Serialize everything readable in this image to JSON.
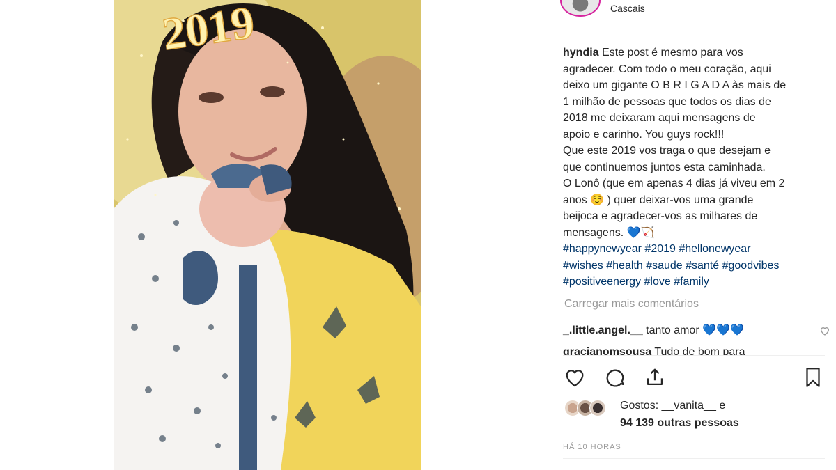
{
  "post": {
    "location": "Cascais",
    "username": "hyndia",
    "caption_lines": [
      "Este post é mesmo para vos",
      "agradecer. Com todo o meu coração, aqui",
      "deixo um gigante O B R I G A D A às mais de",
      "1 milhão de pessoas que todos os dias de",
      "2018 me deixaram aqui mensagens de",
      "apoio e carinho. You guys rock!!!",
      "Que este 2019 vos traga o que desejam e",
      "que continuemos juntos esta caminhada.",
      "O Lonô (que em apenas 4 dias já viveu em 2",
      "anos ☺️ ) quer deixar-vos uma grande",
      "beijoca e agradecer-vos as milhares de",
      "mensagens. 💙🏹"
    ],
    "hashtag_lines": [
      "#happynewyear #2019 #hellonewyear",
      "#wishes #health #saude #santé #goodvibes",
      "#positiveenergy #love #family"
    ]
  },
  "comments": {
    "load_more": "Carregar mais comentários",
    "items": [
      {
        "user": "_.little.angel.__",
        "text": "tanto amor 💙💙💙"
      },
      {
        "user": "gracianomsousa",
        "text": "Tudo de bom para"
      }
    ]
  },
  "likes": {
    "prefix": "Gostos: ",
    "user": "__vanita__",
    "connector": " e",
    "others": "94 139 outras pessoas"
  },
  "time": "HÁ 10 HORAS",
  "photo": {
    "sticker_text": "2019"
  }
}
